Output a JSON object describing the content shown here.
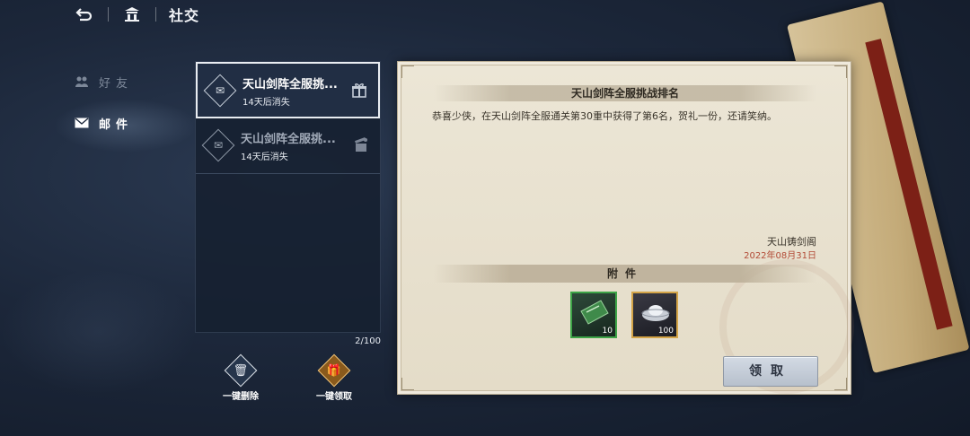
{
  "topbar": {
    "back_icon": "back-arrow-icon",
    "home_icon": "pavilion-icon",
    "title": "社交"
  },
  "nav": {
    "items": [
      {
        "label": "好友",
        "icon": "friends-icon",
        "active": false
      },
      {
        "label": "邮件",
        "icon": "envelope-icon",
        "active": true
      }
    ]
  },
  "mail_list": {
    "items": [
      {
        "title": "天山剑阵全服挑...",
        "expires": "14天后消失",
        "selected": true,
        "read": false,
        "icon": "gift-icon"
      },
      {
        "title": "天山剑阵全服挑...",
        "expires": "14天后消失",
        "selected": false,
        "read": true,
        "icon": "gift-opened-icon"
      }
    ],
    "count": "2/100"
  },
  "actions": {
    "delete_all": "一键删除",
    "claim_all": "一键领取"
  },
  "mail": {
    "title": "天山剑阵全服挑战排名",
    "body": "恭喜少侠，在天山剑阵全服通关第30重中获得了第6名，贺礼一份，还请笑纳。",
    "sender": "天山铸剑阁",
    "date": "2022年08月31日",
    "attachments_label": "附件",
    "attachments": [
      {
        "name": "green-ticket",
        "quantity": "10",
        "rarity_color": "#3da447"
      },
      {
        "name": "silver-ingot",
        "quantity": "100",
        "rarity_color": "#d4a447"
      }
    ],
    "claim_label": "领取"
  }
}
